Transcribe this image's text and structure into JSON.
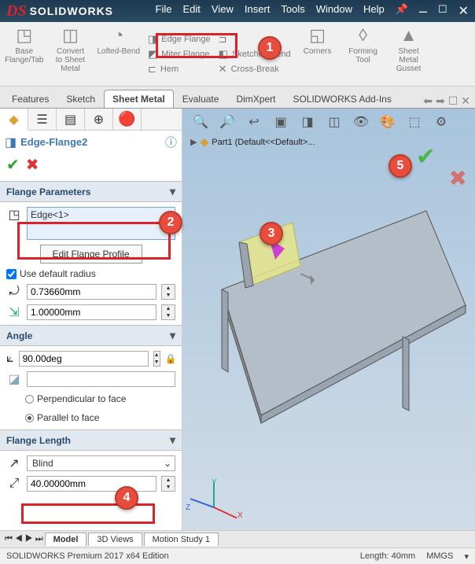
{
  "app": {
    "logo_prefix": "DS",
    "name": "SOLIDWORKS"
  },
  "menu": [
    "File",
    "Edit",
    "View",
    "Insert",
    "Tools",
    "Window",
    "Help"
  ],
  "ribbon_large": [
    {
      "name": "base-flange",
      "label": "Base\nFlange/Tab"
    },
    {
      "name": "convert-sheet",
      "label": "Convert\nto Sheet\nMetal"
    },
    {
      "name": "lofted-bend",
      "label": "Lofted-Bend"
    }
  ],
  "ribbon_sub1": [
    "Edge Flange",
    "Miter Flange",
    "Hem"
  ],
  "ribbon_sub2": [
    "Sketched Bend",
    "Cross-Break"
  ],
  "ribbon_right": [
    {
      "name": "corners",
      "label": "Corners"
    },
    {
      "name": "forming-tool",
      "label": "Forming\nTool"
    },
    {
      "name": "gusset",
      "label": "Sheet\nMetal\nGusset"
    }
  ],
  "tabs": [
    "Features",
    "Sketch",
    "Sheet Metal",
    "Evaluate",
    "DimXpert",
    "SOLIDWORKS Add-Ins"
  ],
  "active_tab": 2,
  "feature": {
    "name": "Edge-Flange2",
    "section_params": "Flange Parameters",
    "selection": "Edge<1>",
    "edit_profile": "Edit Flange Profile",
    "use_default_radius": "Use default radius",
    "radius_value": "0.73660mm",
    "gap_value": "1.00000mm",
    "section_angle": "Angle",
    "angle_value": "90.00deg",
    "face_value": "",
    "perp": "Perpendicular to face",
    "para": "Parallel to face",
    "section_length": "Flange Length",
    "end_cond": "Blind",
    "length_value": "40.00000mm"
  },
  "tree": {
    "label": "Part1  (Default<<Default>..."
  },
  "bottom_tabs": [
    "Model",
    "3D Views",
    "Motion Study 1"
  ],
  "status": {
    "left": "SOLIDWORKS Premium 2017 x64 Edition",
    "length": "Length: 40mm",
    "units": "MMGS"
  },
  "callouts": {
    "1": "1",
    "2": "2",
    "3": "3",
    "4": "4",
    "5": "5"
  },
  "colors": {
    "accent_red": "#d9232a",
    "callout": "#e74c3c",
    "blue_text": "#3b7ab0"
  }
}
